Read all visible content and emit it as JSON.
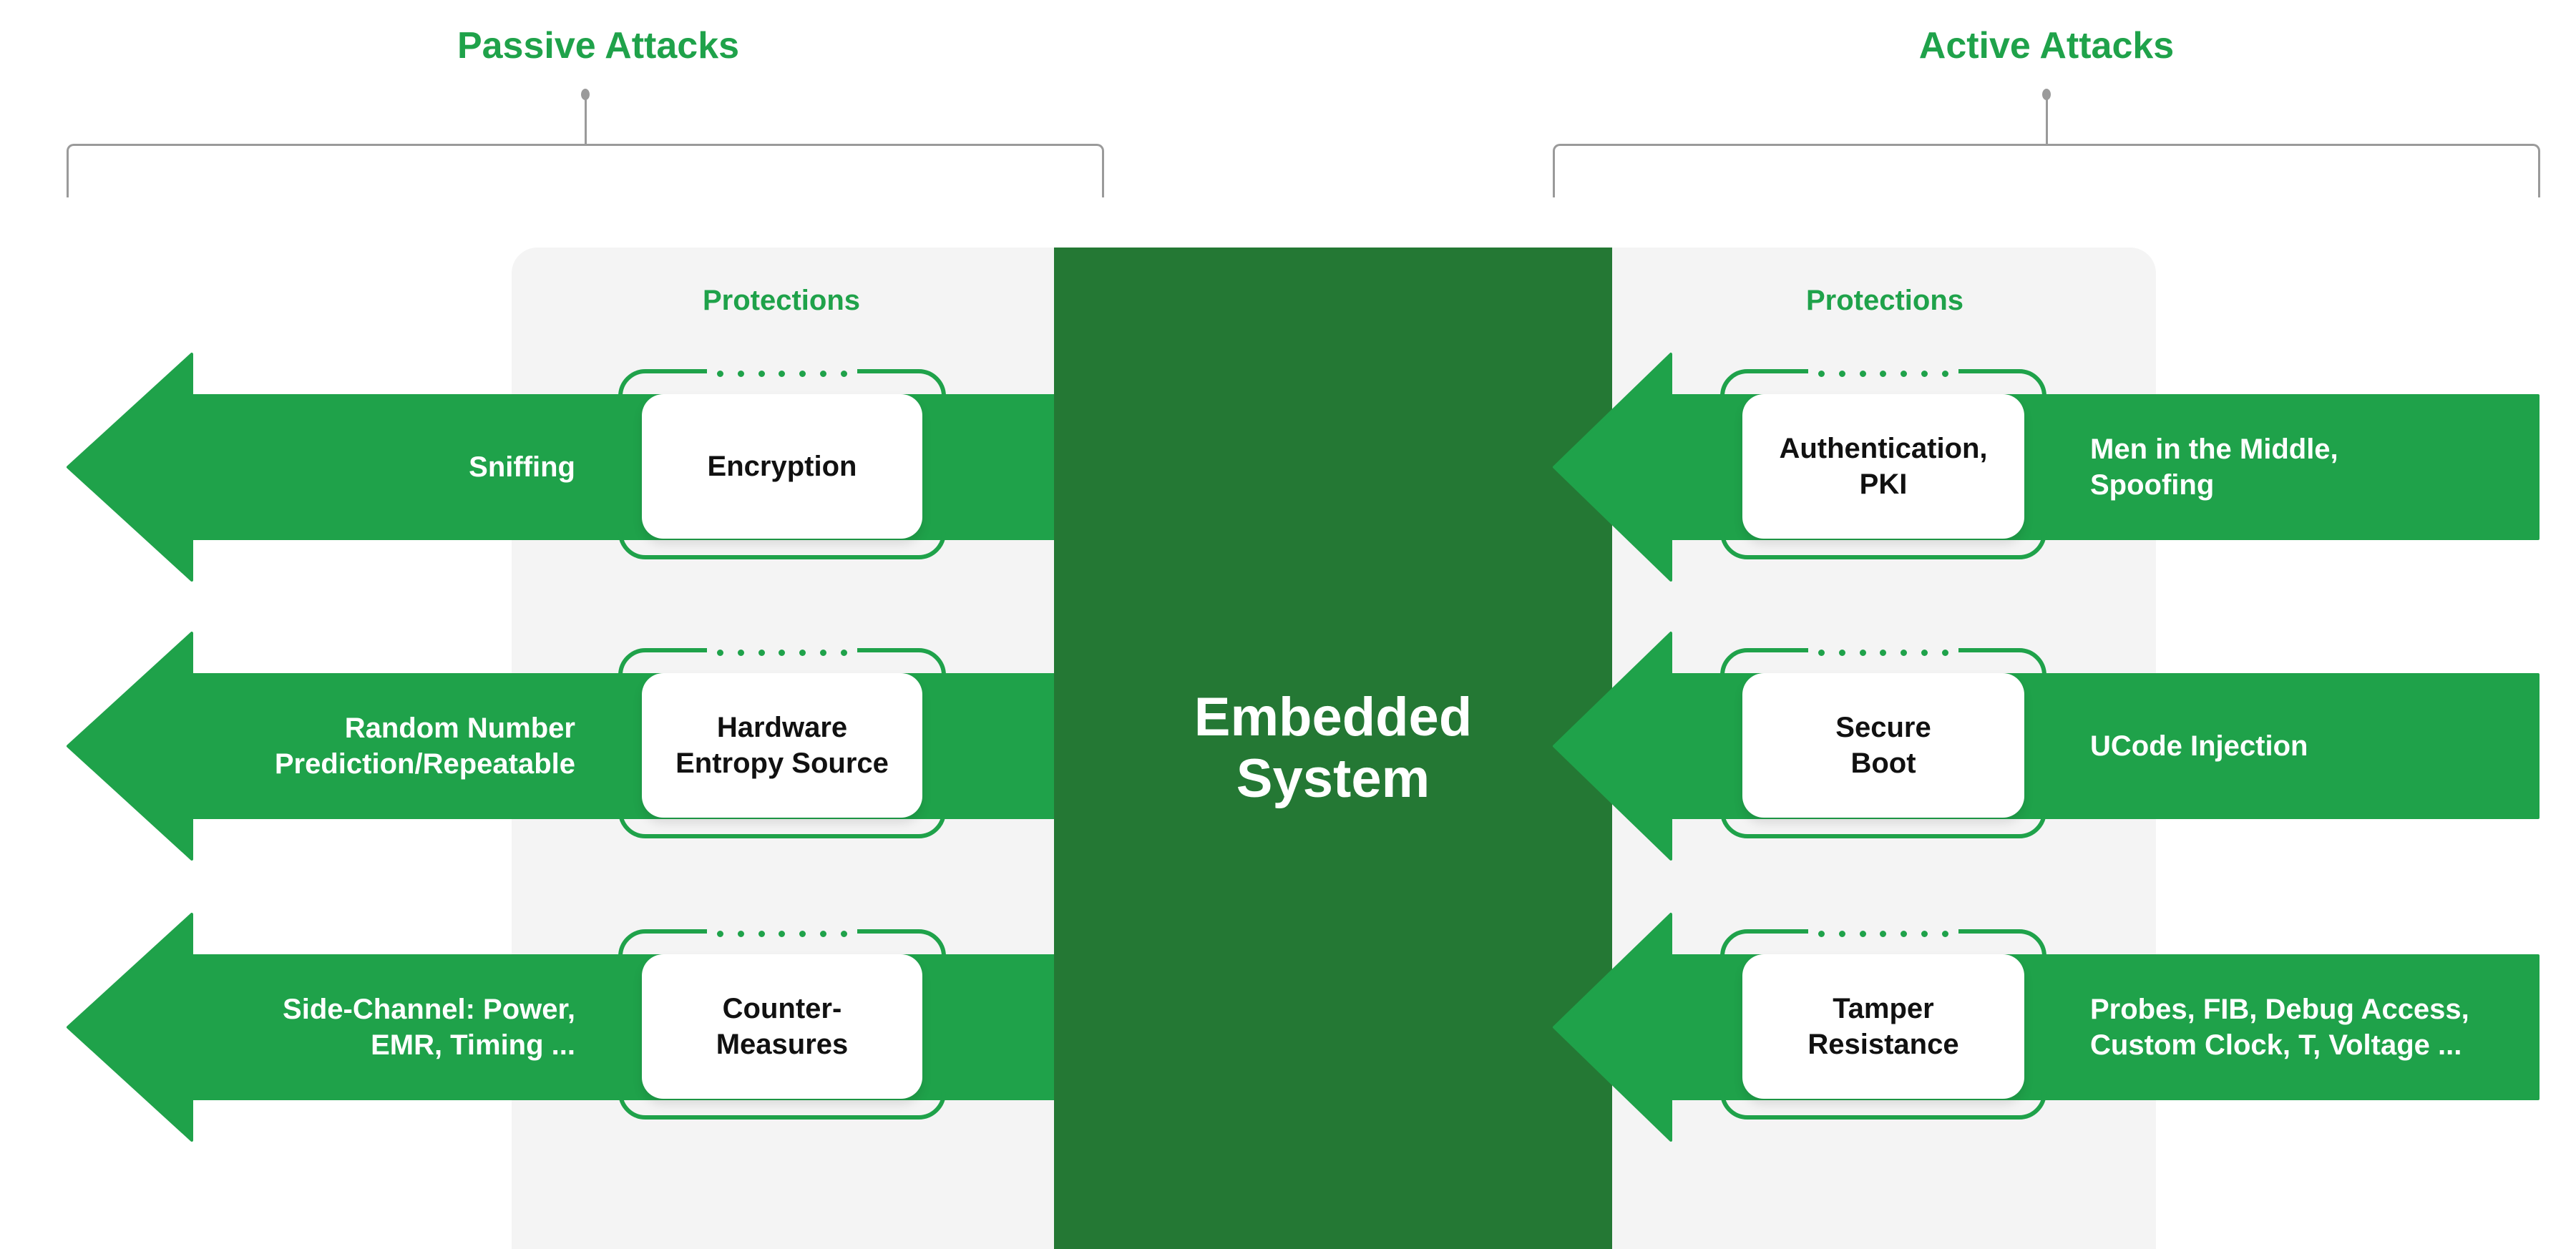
{
  "colors": {
    "accent_green": "#1fa24a",
    "center_green": "#247834",
    "panel_gray": "#f4f4f4",
    "bracket_gray": "#9a9a9a"
  },
  "passive": {
    "title": "Passive Attacks",
    "protections_label": "Protections",
    "rows": [
      {
        "attack": "Sniffing",
        "protection": "Encryption"
      },
      {
        "attack": "Random Number\nPrediction/Repeatable",
        "protection": "Hardware\nEntropy Source"
      },
      {
        "attack": "Side-Channel: Power,\nEMR, Timing ...",
        "protection": "Counter-\nMeasures"
      }
    ]
  },
  "active": {
    "title": "Active Attacks",
    "protections_label": "Protections",
    "rows": [
      {
        "attack": "Men in the Middle,\nSpoofing",
        "protection": "Authentication,\nPKI"
      },
      {
        "attack": "UCode Injection",
        "protection": "Secure\nBoot"
      },
      {
        "attack": "Probes, FIB, Debug Access,\nCustom Clock, T, Voltage ...",
        "protection": "Tamper\nResistance"
      }
    ]
  },
  "center": {
    "label": "Embedded\nSystem"
  }
}
